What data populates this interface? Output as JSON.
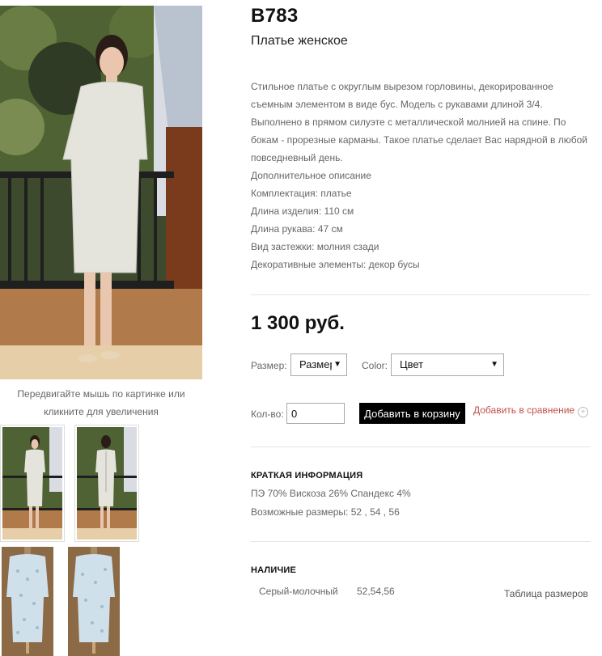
{
  "product": {
    "sku": "B783",
    "name": "Платье женское",
    "description_lines": [
      "Стильное платье с округлым вырезом горловины, декорированное",
      "съемным элементом в виде бус. Модель с рукавами длиной 3/4.",
      "Выполнено в прямом силуэте с металлической молнией на спине. По",
      "бокам - прорезные карманы. Такое платье сделает Вас нарядной в любой",
      "повседневный день.",
      "Дополнительное описание",
      "Комплектация: платье",
      "Длина изделия: 110 см",
      "Длина рукава: 47 см",
      "Вид застежки: молния сзади",
      "Декоративные элементы: декор бусы"
    ],
    "price": "1 300 руб."
  },
  "gallery": {
    "zoom_hint_line1": "Передвигайте мышь по картинке или",
    "zoom_hint_line2": "кликните для увеличения"
  },
  "options": {
    "size_label": "Размер:",
    "size_value": "Размер",
    "color_label": "Color:",
    "color_value": "Цвет"
  },
  "cart": {
    "qty_label": "Кол-во:",
    "qty_value": "0",
    "add_to_cart": "Добавить в корзину",
    "add_to_compare": "Добавить в сравнение",
    "compare_icon": "+"
  },
  "brief_info": {
    "title": "КРАТКАЯ ИНФОРМАЦИЯ",
    "composition": "ПЭ 70% Вискоза 26% Спандекс 4%",
    "sizes": "Возможные размеры: 52 , 54 , 56"
  },
  "availability": {
    "title": "НАЛИЧИЕ",
    "color": "Серый-молочный",
    "sizes": "52,54,56",
    "size_table_link": "Таблица размеров"
  },
  "colors": {
    "accent_link": "#c0504d",
    "button_bg": "#000000",
    "button_text": "#ffffff",
    "dress_grey": "#e4e3dc",
    "dress_blue": "#cfe0ea"
  }
}
